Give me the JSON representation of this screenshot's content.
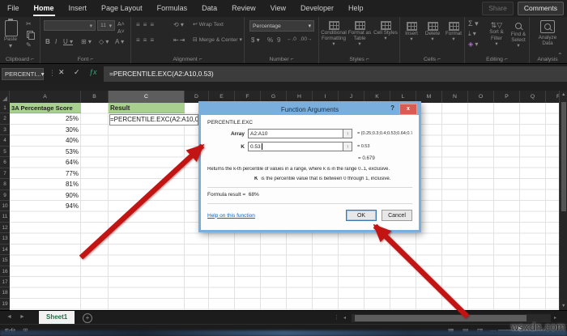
{
  "window": {
    "share": "Share",
    "comments": "Comments"
  },
  "tabs": [
    "File",
    "Home",
    "Insert",
    "Page Layout",
    "Formulas",
    "Data",
    "Review",
    "View",
    "Developer",
    "Help"
  ],
  "active_tab": "Home",
  "ribbon": {
    "groups": [
      "Clipboard",
      "Font",
      "Alignment",
      "Number",
      "Styles",
      "Cells",
      "Editing",
      "Analysis"
    ],
    "paste": "Paste",
    "font_size": "11",
    "number_format": "Percentage",
    "wrap_text": "Wrap Text",
    "merge_center": "Merge & Center",
    "styles_buttons": [
      "Conditional Formatting",
      "Format as Table",
      "Cell Styles"
    ],
    "cells_buttons": [
      "Insert",
      "Delete",
      "Format"
    ],
    "editing_buttons": [
      "Sort & Filter",
      "Find & Select"
    ],
    "analysis_button": "Analyze Data"
  },
  "formula_bar": {
    "name_box": "PERCENTI...",
    "formula": "=PERCENTILE.EXC(A2:A10,0.53)"
  },
  "grid": {
    "column_headers": [
      "A",
      "B",
      "C",
      "D",
      "E",
      "F",
      "G",
      "H",
      "I",
      "J",
      "K",
      "L",
      "M",
      "N",
      "O",
      "P",
      "Q",
      "R"
    ],
    "selected_column": "C",
    "row_count": 20,
    "cells": {
      "a1": "3A Percentage Score",
      "c1": "Result",
      "c2": "=PERCENTILE.EXC(A2:A10,0.53)"
    },
    "scores": [
      "25%",
      "30%",
      "40%",
      "53%",
      "64%",
      "77%",
      "81%",
      "90%",
      "94%"
    ]
  },
  "dialog": {
    "title": "Function Arguments",
    "help_button": "?",
    "close_button": "x",
    "function_name": "PERCENTILE.EXC",
    "array_label": "Array",
    "array_value": "A2:A10",
    "array_result": "=  {0.25;0.3;0.4;0.53;0.64;0.77;0.81;0.9;0.9",
    "k_label": "K",
    "k_value": "0.53",
    "k_result": "=  0.53",
    "result_value": "=  0.679",
    "description": "Returns the k-th percentile of values in a range, where k is in the range 0..1, exclusive.",
    "k_hint_label": "K",
    "k_hint": "is the percentile value that is between 0 through 1, inclusive.",
    "formula_result_label": "Formula result =",
    "formula_result_value": "68%",
    "help_link": "Help on this function",
    "ok": "OK",
    "cancel": "Cancel"
  },
  "sheet_tab": "Sheet1",
  "status": {
    "mode": "Edit"
  },
  "watermark": "wsxdn.com",
  "colors": {
    "excel_green": "#1e7145",
    "header_fill": "#a9d08e",
    "dialog_blue": "#7aaedd",
    "arrow_red": "#c31414",
    "close_red": "#dd5a52"
  }
}
